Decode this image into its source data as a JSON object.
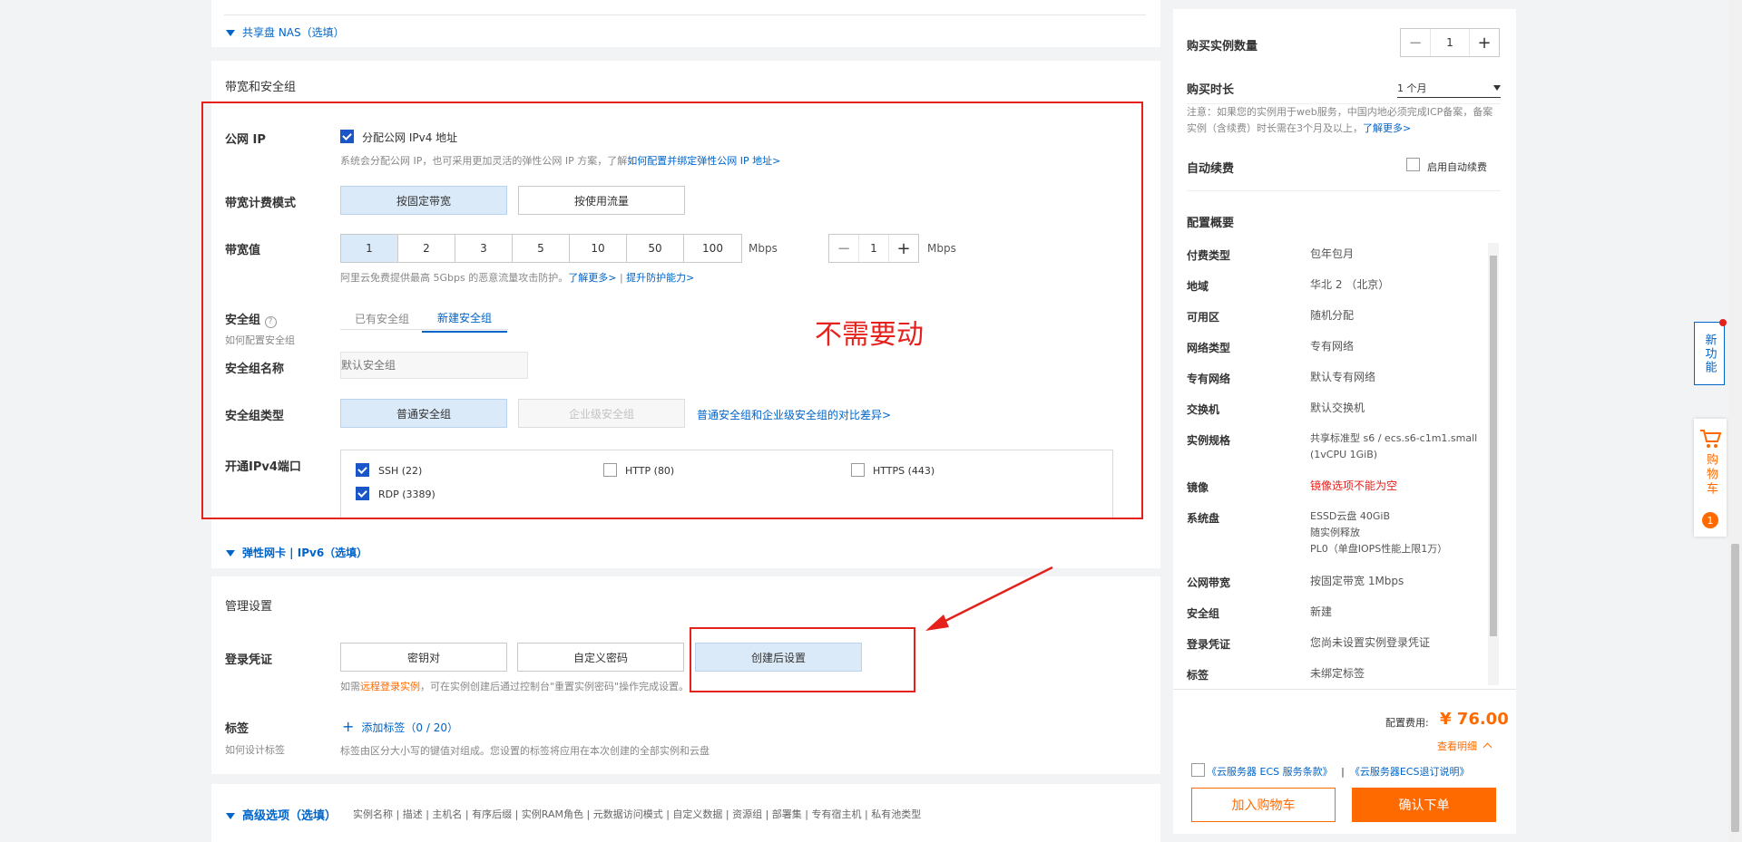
{
  "nas": {
    "label": "共享盘 NAS（选填）"
  },
  "bandwidth_section": {
    "title": "带宽和安全组",
    "public_ip": {
      "label": "公网 IP",
      "checkbox_label": "分配公网 IPv4 地址",
      "hint": "系统会分配公网 IP，也可采用更加灵活的弹性公网 IP 方案，了解",
      "hint_link": "如何配置并绑定弹性公网 IP 地址>"
    },
    "billing_mode": {
      "label": "带宽计费模式",
      "options": [
        "按固定带宽",
        "按使用流量"
      ],
      "selected": "按固定带宽"
    },
    "bandwidth": {
      "label": "带宽值",
      "options": [
        "1",
        "2",
        "3",
        "5",
        "10",
        "50",
        "100"
      ],
      "selected": "1",
      "unit": "Mbps",
      "stepper_value": "1",
      "stepper_unit": "Mbps",
      "hint": "阿里云免费提供最高 5Gbps 的恶意流量攻击防护。",
      "link1": "了解更多>",
      "sep": "|",
      "link2": "提升防护能力>"
    },
    "security_group": {
      "label": "安全组",
      "help": "?",
      "sublabel": "如何配置安全组",
      "tabs": [
        "已有安全组",
        "新建安全组"
      ],
      "active_tab": "新建安全组"
    },
    "sg_name": {
      "label": "安全组名称",
      "placeholder": "默认安全组"
    },
    "sg_type": {
      "label": "安全组类型",
      "options": [
        "普通安全组",
        "企业级安全组"
      ],
      "link": "普通安全组和企业级安全组的对比差异>"
    },
    "ports": {
      "label": "开通IPv4端口",
      "items": [
        {
          "label": "SSH (22)",
          "checked": true
        },
        {
          "label": "HTTP (80)",
          "checked": false
        },
        {
          "label": "HTTPS (443)",
          "checked": false
        },
        {
          "label": "RDP (3389)",
          "checked": true
        }
      ]
    },
    "annotation": "不需要动"
  },
  "eni": {
    "label": "弹性网卡 | IPv6（选填）"
  },
  "management": {
    "title": "管理设置",
    "login": {
      "label": "登录凭证",
      "options": [
        "密钥对",
        "自定义密码",
        "创建后设置"
      ],
      "selected": "创建后设置",
      "hint_pre": "如需",
      "hint_link": "远程登录实例",
      "hint_post": "，可在实例创建后通过控制台\"重置实例密码\"操作完成设置。"
    },
    "tag": {
      "label": "标签",
      "sublabel": "如何设计标签",
      "add_label": "添加标签",
      "count": "（0 / 20）",
      "hint": "标签由区分大小写的键值对组成。您设置的标签将应用在本次创建的全部实例和云盘"
    }
  },
  "advanced": {
    "label": "高级选项（选填）",
    "items": "实例名称 | 描述 | 主机名 | 有序后缀 | 实例RAM角色 | 元数据访问模式 | 自定义数据 | 资源组 | 部署集 | 专有宿主机 | 私有池类型"
  },
  "sidebar": {
    "quantity": {
      "label": "购买实例数量",
      "value": "1"
    },
    "duration": {
      "label": "购买时长",
      "value": "1 个月"
    },
    "note": "注意：如果您的实例用于web服务，中国内地必须完成ICP备案，备案实例（含续费）时长需在3个月及以上，",
    "note_link": "了解更多>",
    "auto_renew": {
      "label": "自动续费",
      "checkbox_label": "启用自动续费"
    },
    "summary_title": "配置概要",
    "summary": [
      {
        "k": "付费类型",
        "v": "包年包月"
      },
      {
        "k": "地域",
        "v": "华北 2 （北京）"
      },
      {
        "k": "可用区",
        "v": "随机分配"
      },
      {
        "k": "网络类型",
        "v": "专有网络"
      },
      {
        "k": "专有网络",
        "v": "默认专有网络"
      },
      {
        "k": "交换机",
        "v": "默认交换机"
      },
      {
        "k": "实例规格",
        "v": "共享标准型 s6 / ecs.s6-c1m1.small",
        "v2": "(1vCPU 1GiB)"
      },
      {
        "k": "镜像",
        "v": "镜像选项不能为空",
        "error": true
      },
      {
        "k": "系统盘",
        "v": "ESSD云盘 40GiB",
        "v2": "随实例释放",
        "v3": "PL0（单盘IOPS性能上限1万）"
      },
      {
        "k": "公网带宽",
        "v": "按固定带宽 1Mbps"
      },
      {
        "k": "安全组",
        "v": "新建"
      },
      {
        "k": "登录凭证",
        "v": "您尚未设置实例登录凭证"
      },
      {
        "k": "标签",
        "v": "未绑定标签"
      }
    ],
    "price_label": "配置费用:",
    "price": "¥ 76.00",
    "detail_link": "查看明细",
    "terms1": "《云服务器 ECS 服务条款》",
    "terms_sep": "|",
    "terms2": "《云服务器ECS退订说明》",
    "add_cart": "加入购物车",
    "confirm": "确认下单"
  },
  "float": {
    "new_feature": "新功能",
    "cart": "购物车",
    "cart_count": "1"
  },
  "colors": {
    "accent": "#0064c8",
    "orange": "#ff6a00",
    "annotation": "#e5211c",
    "selected_bg": "#dbeaf8"
  }
}
